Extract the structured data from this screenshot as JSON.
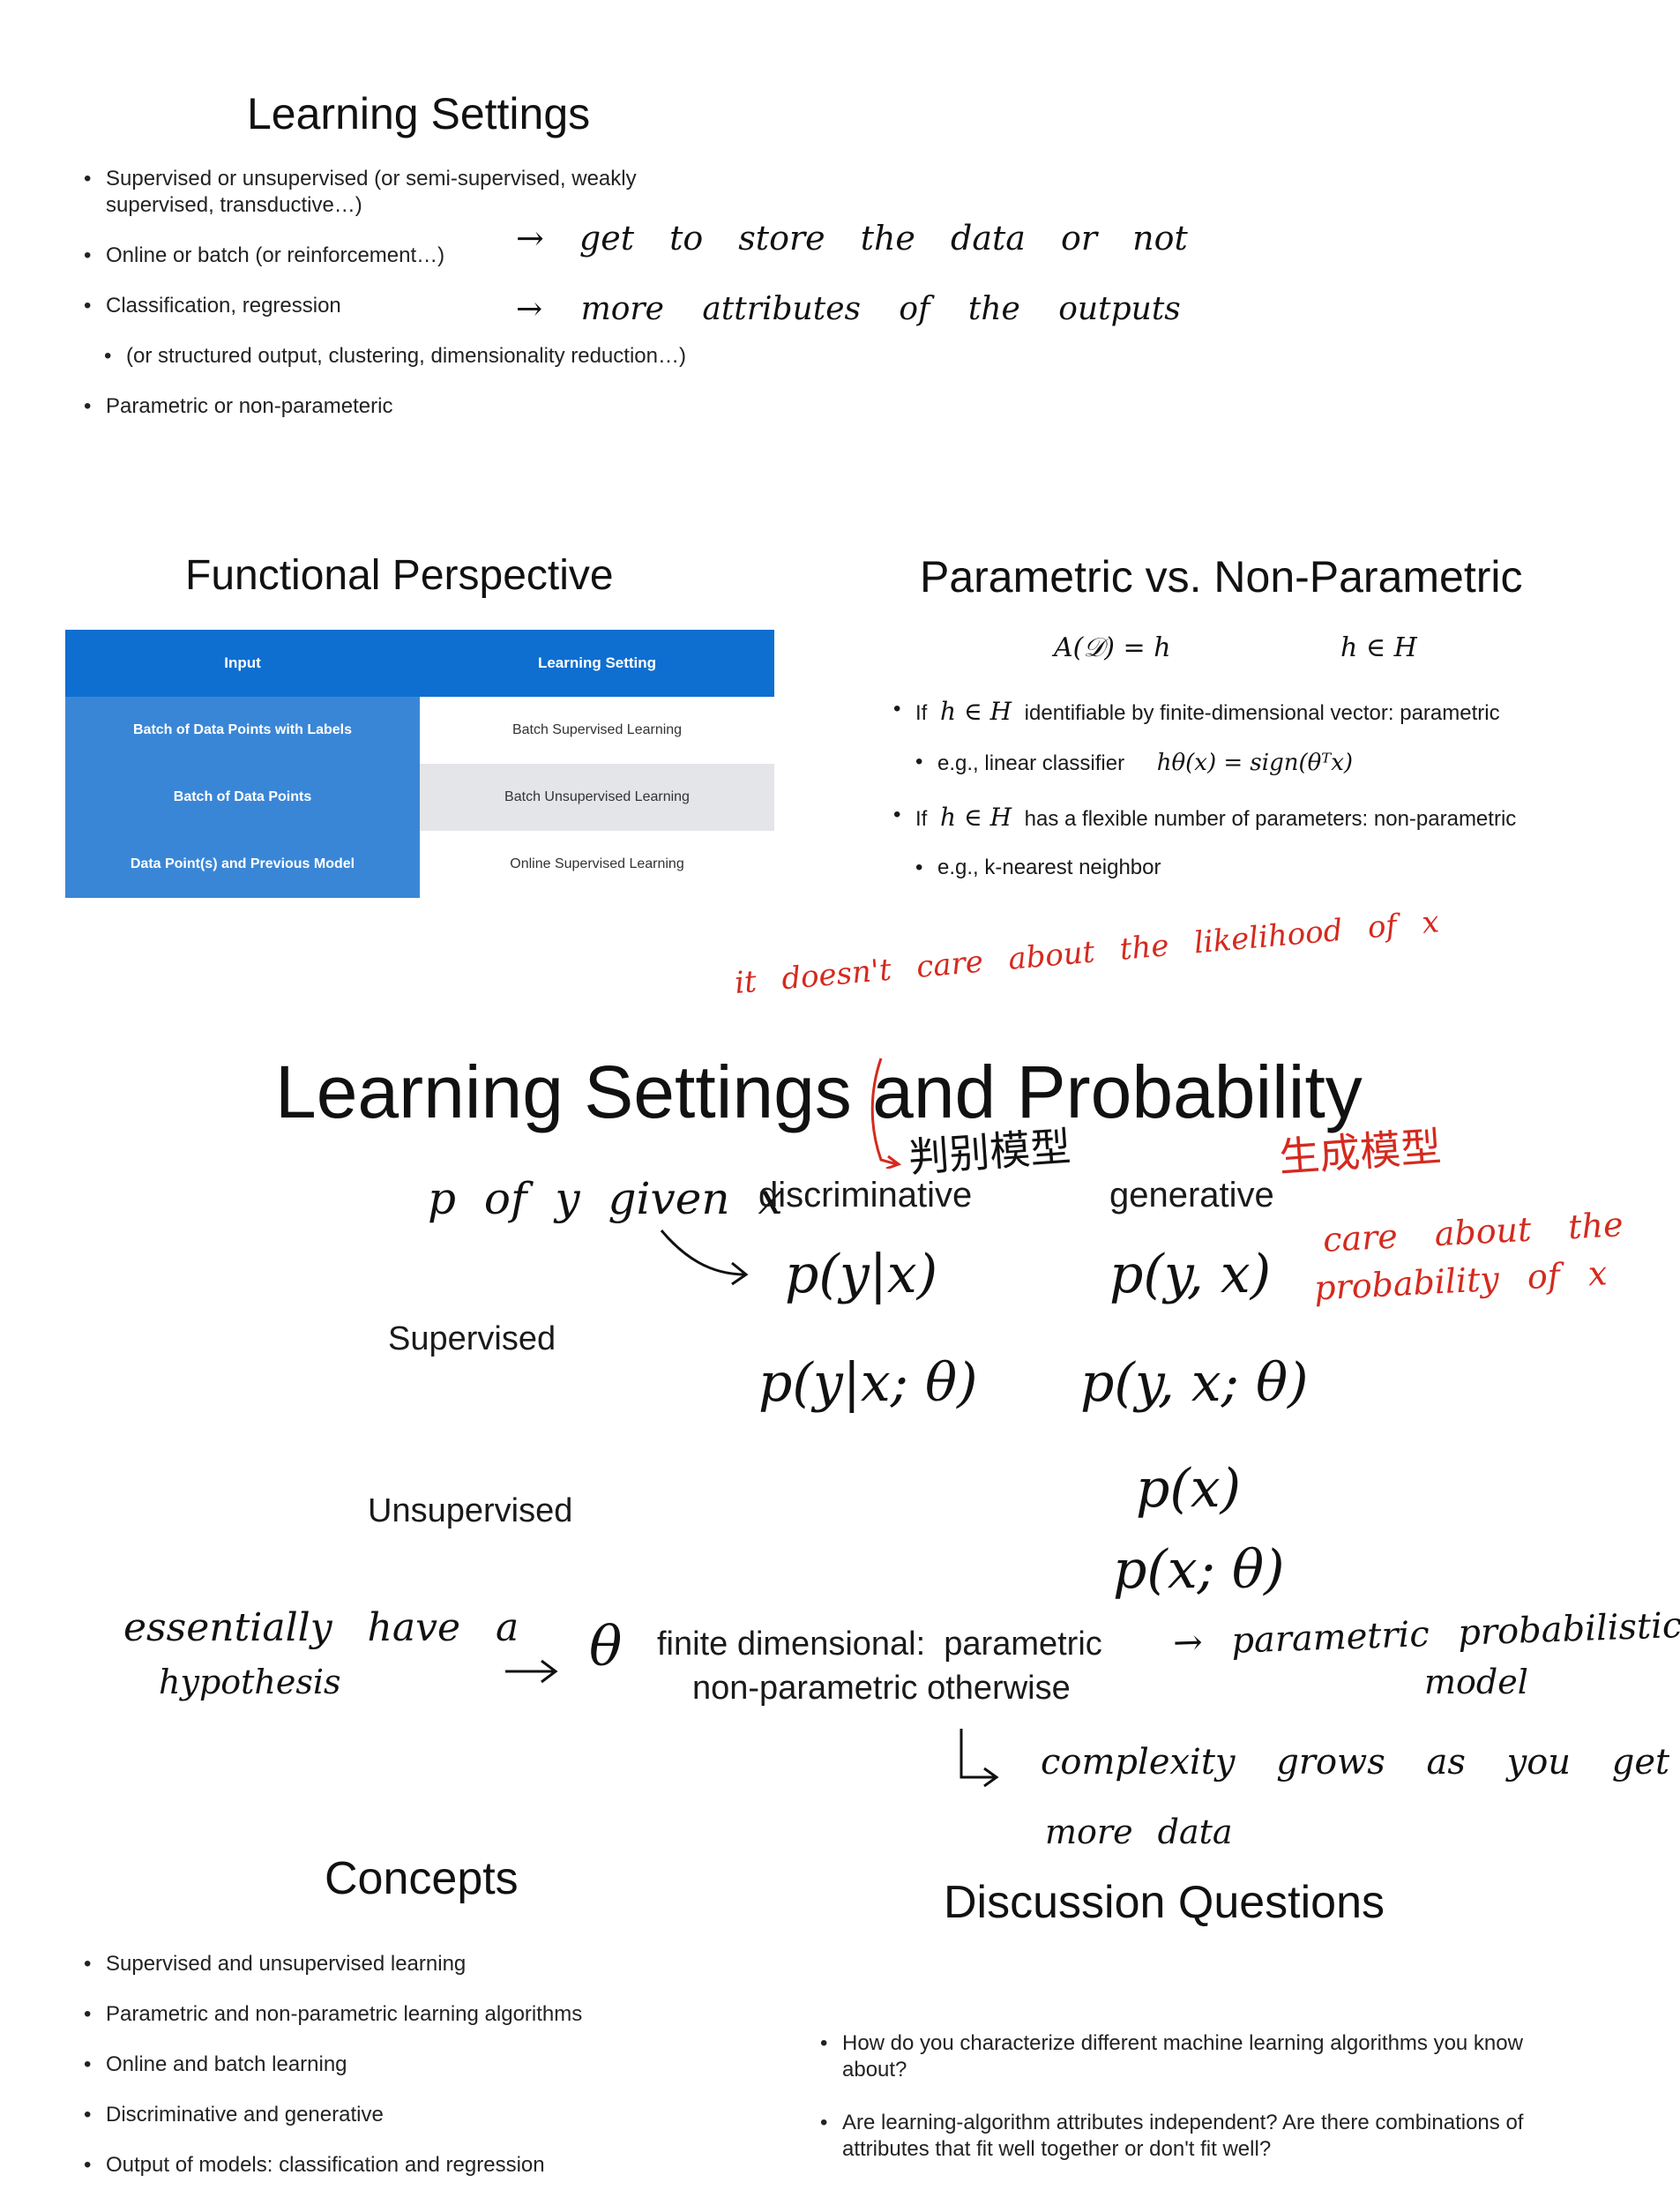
{
  "slide1": {
    "title": "Learning Settings",
    "bullets": [
      "Supervised or unsupervised (or semi-supervised, weakly supervised, transductive…)",
      "Online or batch (or reinforcement…)",
      "Classification, regression",
      "(or structured output, clustering, dimensionality reduction…)",
      "Parametric or non-parameteric"
    ],
    "notes": [
      "→ get to store the data or not",
      "→ more attributes of the outputs"
    ]
  },
  "slide2": {
    "title": "Functional Perspective",
    "headers": [
      "Input",
      "Learning Setting"
    ],
    "rows": [
      [
        "Batch of Data Points with Labels",
        "Batch Supervised Learning"
      ],
      [
        "Batch of Data Points",
        "Batch Unsupervised Learning"
      ],
      [
        "Data Point(s) and Previous Model",
        "Online Supervised Learning"
      ]
    ]
  },
  "slide3": {
    "title": "Parametric vs. Non-Parametric",
    "formula_left": "A(𝒟) = h",
    "formula_right": "h ∈ H",
    "b1_pre": "If",
    "b1_math": "h ∈ H",
    "b1_post": "identifiable by finite-dimensional vector: parametric",
    "b2_pre": "e.g., linear classifier",
    "b2_math": "hθ(x) = sign(θᵀx)",
    "b3_pre": "If",
    "b3_math": "h ∈ H",
    "b3_post": "has a flexible number of parameters: non-parametric",
    "b4": "e.g., k-nearest neighbor"
  },
  "slide4": {
    "title": "Learning Settings and Probability",
    "col_discriminative": "discriminative",
    "col_generative": "generative",
    "row_supervised": "Supervised",
    "row_unsupervised": "Unsupervised",
    "f_disc1": "p(y|x)",
    "f_gen1": "p(y, x)",
    "f_disc2": "p(y|x; θ)",
    "f_gen2": "p(y, x; θ)",
    "f_unsup1": "p(x)",
    "f_unsup2": "p(x; θ)",
    "theta": "θ",
    "param_line1": "finite dimensional:  parametric",
    "param_line2": "non-parametric otherwise",
    "notes": {
      "likelihood": "it doesn't care about the likelihood of x",
      "discriminative_cn": "判别模型",
      "generative_cn": "生成模型",
      "given": "p of y given x",
      "care_about": "care about the",
      "probability_of": "probability of x",
      "essentially": "essentially have a",
      "hypothesis": "hypothesis",
      "ppm1": "→ parametric probabilistic",
      "ppm2": "model",
      "complexity": "complexity grows as you get",
      "more_data": "more data"
    }
  },
  "slide5": {
    "title": "Concepts",
    "bullets": [
      "Supervised and unsupervised learning",
      "Parametric and non-parametric learning algorithms",
      "Online and batch learning",
      "Discriminative and generative",
      "Output of models: classification and regression"
    ]
  },
  "slide6": {
    "title": "Discussion Questions",
    "bullets": [
      "How do you characterize different machine learning algorithms you know about?",
      "Are learning-algorithm attributes independent? Are there combinations of attributes that fit well together or don't fit well?"
    ]
  },
  "colors": {
    "table_header": "#0e6fd0",
    "table_rowhead": "#3a86d6",
    "annotation_red": "#d42a1f"
  }
}
